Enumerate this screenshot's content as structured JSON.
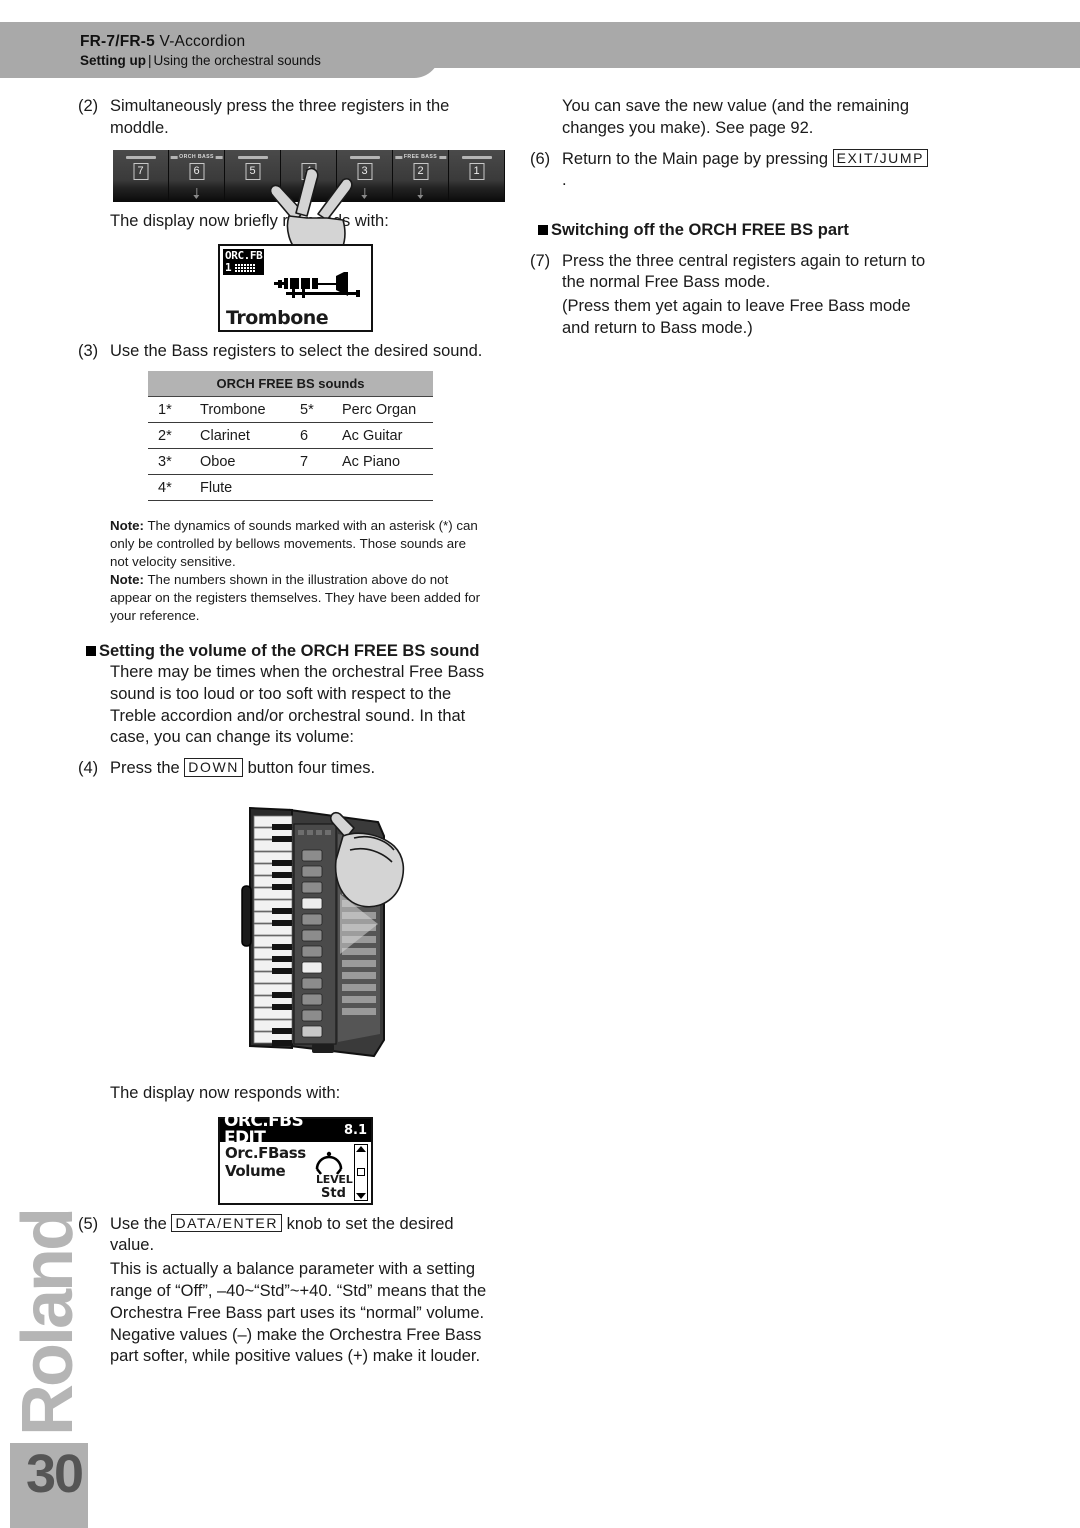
{
  "header": {
    "product_bold": "FR-7/FR-5",
    "product_light": "V-Accordion",
    "section_bold": "Setting up",
    "separator": "|",
    "section_light": "Using the orchestral sounds"
  },
  "left_column": {
    "step2": {
      "num": "(2)",
      "text": "Simultaneously press the three registers in the moddle."
    },
    "registers_caption": "The display now briefly responds with:",
    "register_strip": {
      "label_orch": "ORCH BASS",
      "label_free": "FREE BASS",
      "buttons": [
        {
          "num": "7",
          "label": "",
          "arrow": false
        },
        {
          "num": "6",
          "label": "ORCH BASS",
          "arrow": true
        },
        {
          "num": "5",
          "label": "",
          "arrow": false
        },
        {
          "num": "4",
          "label": "",
          "arrow": true
        },
        {
          "num": "3",
          "label": "",
          "arrow": true
        },
        {
          "num": "2",
          "label": "FREE BASS",
          "arrow": true
        },
        {
          "num": "1",
          "label": "",
          "arrow": false
        }
      ]
    },
    "lcd1": {
      "badge_top": "ORC.FB",
      "badge_num": "1",
      "badge_icon": "dot-grid-icon",
      "instrument_icon": "trombone-icon",
      "sound_name": "Trombone"
    },
    "step3": {
      "num": "(3)",
      "text": "Use the Bass registers to select the desired sound."
    },
    "table": {
      "header": "ORCH FREE BS sounds",
      "rows": [
        {
          "n1": "1*",
          "s1": "Trombone",
          "n2": "5*",
          "s2": "Perc Organ"
        },
        {
          "n1": "2*",
          "s1": "Clarinet",
          "n2": "6",
          "s2": "Ac Guitar"
        },
        {
          "n1": "3*",
          "s1": "Oboe",
          "n2": "7",
          "s2": "Ac Piano"
        },
        {
          "n1": "4*",
          "s1": "Flute",
          "n2": "",
          "s2": ""
        }
      ]
    },
    "note1_label": "Note:",
    "note1_text": " The dynamics of sounds marked with an asterisk (*) can only be controlled by bellows movements. Those sounds are not velocity sensitive.",
    "note2_label": "Note:",
    "note2_text": " The numbers shown in the illustration above do not appear on the registers themselves. They have been added for your reference.",
    "section_heading": "Setting the volume of the ORCH FREE BS sound",
    "section_body": "There may be times when the orchestral Free Bass sound is too loud or too soft with respect to the Treble accordion and/or orchestral sound. In that case, you can change its volume:",
    "step4": {
      "num": "(4)",
      "before": "Press the ",
      "key": "DOWN",
      "after": " button four times."
    },
    "accordion_icon": "v-accordion-illustration",
    "accordion_caption": "The display now responds with:",
    "lcd2": {
      "title": "ORC.FBS EDIT",
      "version": "8.1",
      "line1": "Orc.FBass",
      "line2": "Volume",
      "knob_icon": "rotary-knob-icon",
      "level_label": "LEVEL",
      "level_value": "Std",
      "scroll_up_icon": "triangle-up-icon",
      "scroll_thumb_icon": "scroll-thumb-icon",
      "scroll_down_icon": "triangle-down-icon"
    },
    "step5": {
      "num": "(5)",
      "before": "Use the ",
      "key": "DATA/ENTER",
      "after": " knob to set the desired value."
    },
    "step5_body": "This is actually a balance parameter with a setting range of “Off”, –40~“Std”~+40. “Std” means that the Orchestra Free Bass part uses its “normal” volume. Negative values (–) make the Orchestra Free Bass part softer, while positive values (+) make it louder."
  },
  "right_column": {
    "intro": "You can save the new value (and the remaining changes you make). See page 92.",
    "step6": {
      "num": "(6)",
      "before": "Return to the Main page by pressing ",
      "key": "EXIT/JUMP",
      "after": "."
    },
    "section_heading": "Switching off the ORCH FREE BS part",
    "step7": {
      "num": "(7)",
      "text": "Press the three central registers again to return to the normal Free Bass mode."
    },
    "step7_note": "(Press them yet again to leave Free Bass mode and return to Bass mode.)"
  },
  "footer": {
    "brand": "Roland",
    "page_number": "30"
  },
  "colors": {
    "header_band": "#a9a9a9",
    "table_header": "#b3b3b3",
    "brand_gray": "#b5b5b5",
    "page_square": "#b0b0b0"
  }
}
